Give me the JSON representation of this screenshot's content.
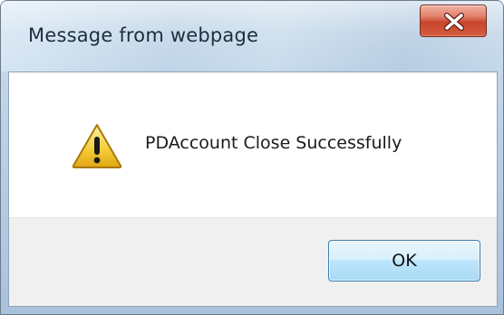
{
  "dialog": {
    "title": "Message from webpage",
    "message": "PDAccount Close Successfully",
    "icon": "warning-icon",
    "close_icon": "close-icon",
    "ok_label": "OK"
  },
  "colors": {
    "title_bar": "#bfd4e7",
    "close_button": "#c8452c",
    "ok_button_border": "#3c7fb1",
    "button_area": "#f0f0f0",
    "warning_fill": "#f6cf3c"
  }
}
